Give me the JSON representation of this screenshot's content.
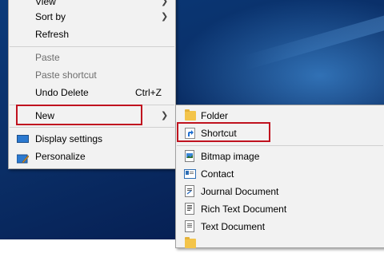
{
  "context_menu": {
    "items": [
      {
        "label": "View"
      },
      {
        "label": "Sort by"
      },
      {
        "label": "Refresh"
      },
      {
        "label": "Paste"
      },
      {
        "label": "Paste shortcut"
      },
      {
        "label": "Undo Delete",
        "shortcut": "Ctrl+Z"
      },
      {
        "label": "New"
      },
      {
        "label": "Display settings",
        "icon": "display-icon"
      },
      {
        "label": "Personalize",
        "icon": "personalize-icon"
      }
    ]
  },
  "new_submenu": {
    "items": [
      {
        "label": "Folder",
        "icon": "folder-icon"
      },
      {
        "label": "Shortcut",
        "icon": "shortcut-icon"
      },
      {
        "label": "Bitmap image",
        "icon": "bitmap-icon"
      },
      {
        "label": "Contact",
        "icon": "contact-icon"
      },
      {
        "label": "Journal Document",
        "icon": "journal-icon"
      },
      {
        "label": "Rich Text Document",
        "icon": "rich-text-icon"
      },
      {
        "label": "Text Document",
        "icon": "text-document-icon"
      }
    ]
  },
  "colors": {
    "menu_background": "#f2f2f2",
    "highlight_border": "#c0121f",
    "desktop_background": "#0a2e66"
  }
}
